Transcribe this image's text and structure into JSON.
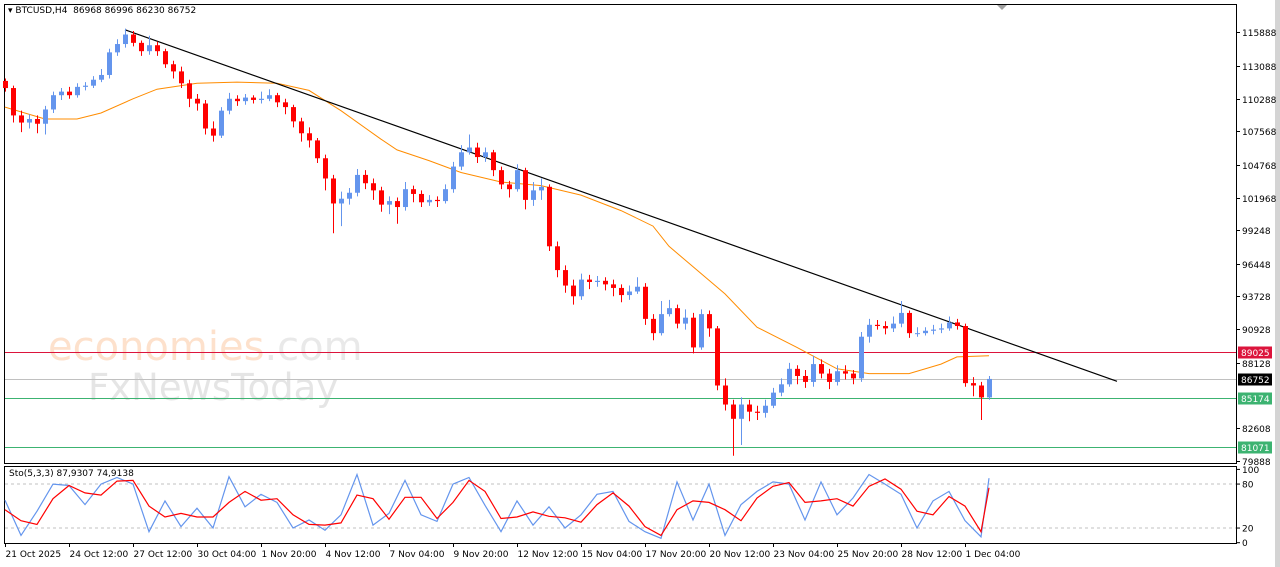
{
  "header": {
    "symbol": "BTCUSD,H4",
    "ohlc": "86968 86996 86230 86752"
  },
  "indicator": {
    "label": "Sto(5,3,3) 87,9307 74,9138"
  },
  "watermark": {
    "line1": "economies.com",
    "line2": "FxNewsToday"
  },
  "colors": {
    "bull": "#6495ED",
    "bear": "#FF0000",
    "ma": "#FF8C00",
    "trendline": "#000000",
    "resistance": "#DC143C",
    "support": "#3CB371",
    "current": "#C0C0C0",
    "sto_k": "#6495ED",
    "sto_d": "#FF0000"
  },
  "chart_data": [
    {
      "type": "candlestick",
      "ylim": [
        79770,
        118265
      ],
      "y_ticks": [
        115888,
        113088,
        110288,
        107568,
        104768,
        101968,
        99248,
        96448,
        93728,
        90928,
        88128,
        82608,
        79888
      ],
      "x_tick_labels": [
        "21 Oct 2025",
        "24 Oct 12:00",
        "27 Oct 12:00",
        "30 Oct 04:00",
        "1 Nov 20:00",
        "4 Nov 12:00",
        "7 Nov 04:00",
        "9 Nov 20:00",
        "12 Nov 12:00",
        "15 Nov 04:00",
        "17 Nov 20:00",
        "20 Nov 12:00",
        "23 Nov 04:00",
        "25 Nov 20:00",
        "28 Nov 12:00",
        "1 Dec 04:00"
      ],
      "first_open": 111800,
      "close": [
        111200,
        108900,
        108300,
        108600,
        108200,
        109400,
        110600,
        110900,
        110600,
        111300,
        111400,
        111900,
        112300,
        114200,
        114900,
        115700,
        115000,
        114300,
        114800,
        114300,
        113200,
        112600,
        111600,
        110300,
        109900,
        107800,
        107200,
        109300,
        110300,
        110100,
        110400,
        110200,
        110300,
        110600,
        110000,
        109600,
        108400,
        107400,
        106800,
        105300,
        103600,
        101500,
        101900,
        102400,
        103900,
        103200,
        102600,
        101400,
        101700,
        101200,
        102700,
        102300,
        101600,
        101800,
        101700,
        102700,
        104600,
        105800,
        106200,
        105400,
        105800,
        104300,
        103100,
        102700,
        104300,
        101800,
        102600,
        102900,
        97900,
        95900,
        94600,
        93700,
        95100,
        94900,
        95000,
        94700,
        94400,
        93800,
        94100,
        94500,
        91800,
        90600,
        92200,
        92700,
        91400,
        91900,
        89400,
        92200,
        91000,
        86200,
        84600,
        83400,
        84600,
        84000,
        83900,
        84500,
        85600,
        86300,
        87600,
        87000,
        86500,
        88000,
        87200,
        86500,
        87400,
        87200,
        86800,
        90300,
        91300,
        91200,
        91000,
        91400,
        92300,
        90600,
        90600,
        90800,
        90900,
        91000,
        91500,
        91200,
        86400,
        86200,
        85200,
        86752
      ],
      "high": [
        112000,
        111400,
        109300,
        109000,
        108900,
        109700,
        110900,
        111200,
        111300,
        111600,
        111700,
        112200,
        112800,
        114500,
        115300,
        116200,
        116000,
        115200,
        115600,
        115100,
        114500,
        113500,
        113000,
        111900,
        110700,
        110200,
        108400,
        109600,
        110800,
        110600,
        110700,
        110600,
        110900,
        111100,
        110800,
        110300,
        109800,
        108700,
        107900,
        107000,
        105600,
        103900,
        102500,
        102800,
        104400,
        104300,
        103600,
        102900,
        102100,
        102000,
        103300,
        103000,
        102600,
        102200,
        102100,
        103100,
        105000,
        106400,
        107300,
        106600,
        106200,
        106000,
        104600,
        103400,
        104800,
        104500,
        103300,
        103600,
        103100,
        98300,
        96300,
        95100,
        95600,
        95500,
        95400,
        95300,
        95100,
        94700,
        94600,
        95300,
        94800,
        92200,
        93300,
        93400,
        93000,
        92600,
        92300,
        92600,
        92500,
        91200,
        86800,
        85000,
        85200,
        85000,
        84500,
        85000,
        86000,
        86800,
        88100,
        87900,
        87500,
        88700,
        88400,
        87600,
        87900,
        87900,
        87500,
        90700,
        91800,
        91700,
        91600,
        92000,
        93300,
        92500,
        91100,
        91100,
        91300,
        91400,
        92000,
        91800,
        91400,
        86900,
        86500,
        86996
      ],
      "low": [
        110900,
        108300,
        107500,
        107800,
        107400,
        107300,
        109100,
        110200,
        110300,
        110400,
        111000,
        111200,
        111700,
        112000,
        113900,
        114600,
        114700,
        113900,
        114000,
        113900,
        112900,
        112000,
        111200,
        109600,
        109300,
        107300,
        106700,
        107000,
        109000,
        109700,
        109800,
        109900,
        109900,
        110100,
        109600,
        109000,
        107900,
        106700,
        106200,
        104900,
        102600,
        99000,
        99600,
        101400,
        102100,
        102700,
        101800,
        100800,
        100600,
        99800,
        100900,
        101600,
        101200,
        101300,
        101200,
        101500,
        102400,
        104300,
        105600,
        104900,
        105000,
        103800,
        102700,
        102000,
        102500,
        101000,
        101300,
        101800,
        97500,
        95300,
        94000,
        93000,
        93400,
        94300,
        94500,
        94200,
        93700,
        93200,
        93400,
        93900,
        91300,
        90000,
        90400,
        92000,
        91000,
        90900,
        88900,
        89200,
        90300,
        85800,
        84100,
        80300,
        81200,
        83200,
        83300,
        83500,
        84300,
        85300,
        86100,
        86300,
        86000,
        86100,
        86800,
        85900,
        86200,
        86700,
        86300,
        86500,
        89800,
        90900,
        90500,
        90700,
        91100,
        90200,
        90300,
        90400,
        90500,
        90600,
        90800,
        90900,
        86100,
        85300,
        83300,
        85000
      ],
      "moving_average": [
        [
          0,
          109600
        ],
        [
          5,
          108600
        ],
        [
          9,
          108600
        ],
        [
          12,
          109100
        ],
        [
          16,
          110300
        ],
        [
          19,
          111100
        ],
        [
          24,
          111600
        ],
        [
          29,
          111700
        ],
        [
          34,
          111600
        ],
        [
          38,
          111000
        ],
        [
          42,
          109300
        ],
        [
          47,
          106900
        ],
        [
          49,
          106000
        ],
        [
          53,
          105100
        ],
        [
          57,
          104100
        ],
        [
          62,
          103300
        ],
        [
          67,
          103000
        ],
        [
          72,
          102200
        ],
        [
          77,
          100900
        ],
        [
          81,
          99600
        ],
        [
          83,
          97900
        ],
        [
          90,
          93900
        ],
        [
          94,
          91100
        ],
        [
          99,
          89400
        ],
        [
          104,
          87600
        ],
        [
          108,
          87200
        ],
        [
          113,
          87200
        ],
        [
          117,
          88000
        ],
        [
          119,
          88600
        ],
        [
          123,
          88700
        ]
      ],
      "trendline": {
        "from": [
          15,
          116100
        ],
        "to": [
          139,
          86550
        ]
      },
      "levels": [
        {
          "price": 89025,
          "label": "89025",
          "kind": "resistance"
        },
        {
          "price": 86752,
          "label": "86752",
          "kind": "current"
        },
        {
          "price": 85174,
          "label": "85174",
          "kind": "support"
        },
        {
          "price": 81071,
          "label": "81071",
          "kind": "support"
        }
      ]
    },
    {
      "type": "line",
      "name": "Sto(5,3,3)",
      "ylim": [
        0,
        100
      ],
      "y_ticks": [
        100,
        80,
        20,
        0
      ],
      "levels": [
        80,
        20
      ],
      "series": [
        {
          "name": "%K",
          "values": [
            58,
            10,
            43,
            80,
            78,
            52,
            80,
            89,
            80,
            15,
            57,
            22,
            47,
            20,
            90,
            49,
            66,
            55,
            20,
            31,
            17,
            38,
            93,
            24,
            40,
            85,
            38,
            29,
            80,
            89,
            51,
            15,
            57,
            24,
            49,
            20,
            38,
            66,
            70,
            29,
            15,
            6,
            83,
            31,
            80,
            10,
            52,
            70,
            83,
            80,
            31,
            83,
            38,
            61,
            93,
            80,
            66,
            20,
            57,
            70,
            30,
            8,
            87.93
          ]
        },
        {
          "name": "%D",
          "values": [
            45,
            30,
            25,
            60,
            78,
            68,
            65,
            84,
            85,
            50,
            35,
            40,
            35,
            35,
            55,
            70,
            58,
            60,
            38,
            25,
            24,
            27,
            65,
            60,
            32,
            62,
            62,
            33,
            55,
            85,
            70,
            33,
            35,
            42,
            36,
            34,
            28,
            52,
            68,
            50,
            22,
            10,
            45,
            57,
            55,
            45,
            30,
            61,
            77,
            82,
            55,
            57,
            60,
            50,
            77,
            87,
            73,
            43,
            38,
            63,
            50,
            15,
            74.91
          ]
        }
      ]
    }
  ]
}
